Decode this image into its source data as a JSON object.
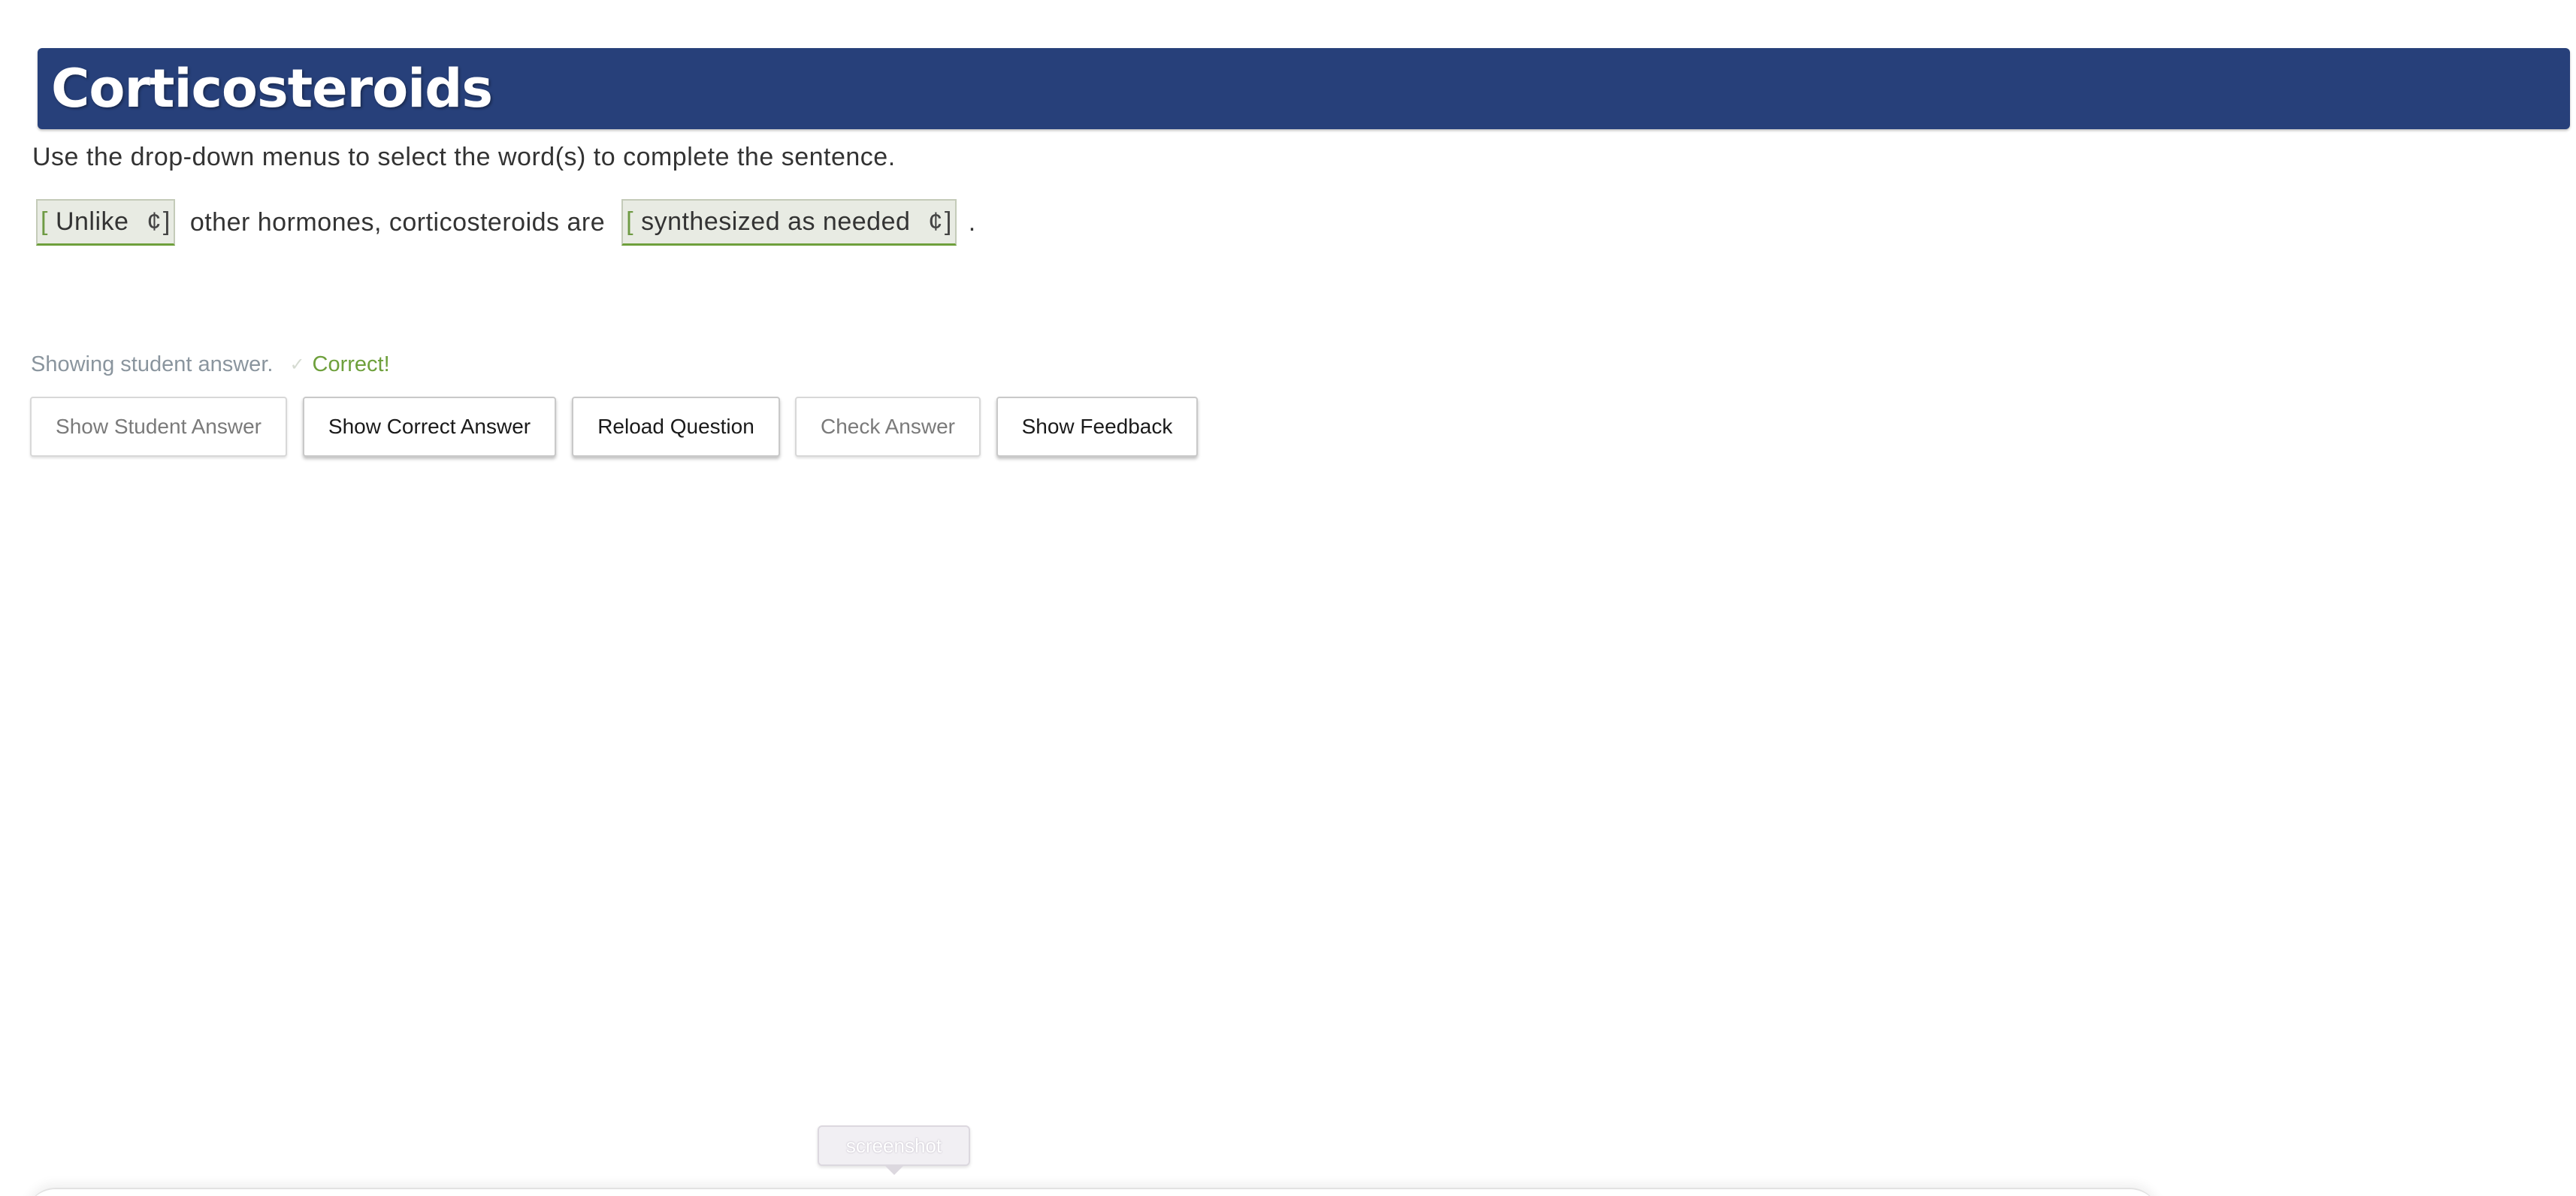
{
  "header": {
    "title": "Corticosteroids",
    "background_color": "#27407a"
  },
  "question": {
    "instructions": "Use the drop-down menus to select the word(s) to complete the sentence.",
    "dropdown_1": {
      "open_bracket": "[",
      "value": "Unlike",
      "caret": "¢",
      "close_bracket": "]"
    },
    "text_middle": "other hormones, corticosteroids are",
    "dropdown_2": {
      "open_bracket": "[",
      "value": "synthesized as needed",
      "caret": "¢",
      "close_bracket": "]"
    },
    "text_end": "."
  },
  "status": {
    "showing": "Showing student answer.",
    "icon": "check-icon",
    "result": "Correct!",
    "result_color": "#6ea03c"
  },
  "buttons": {
    "show_student_answer": "Show Student Answer",
    "show_correct_answer": "Show Correct Answer",
    "reload_question": "Reload Question",
    "check_answer": "Check Answer",
    "show_feedback": "Show Feedback"
  },
  "tooltip": {
    "label": "screenshot"
  }
}
